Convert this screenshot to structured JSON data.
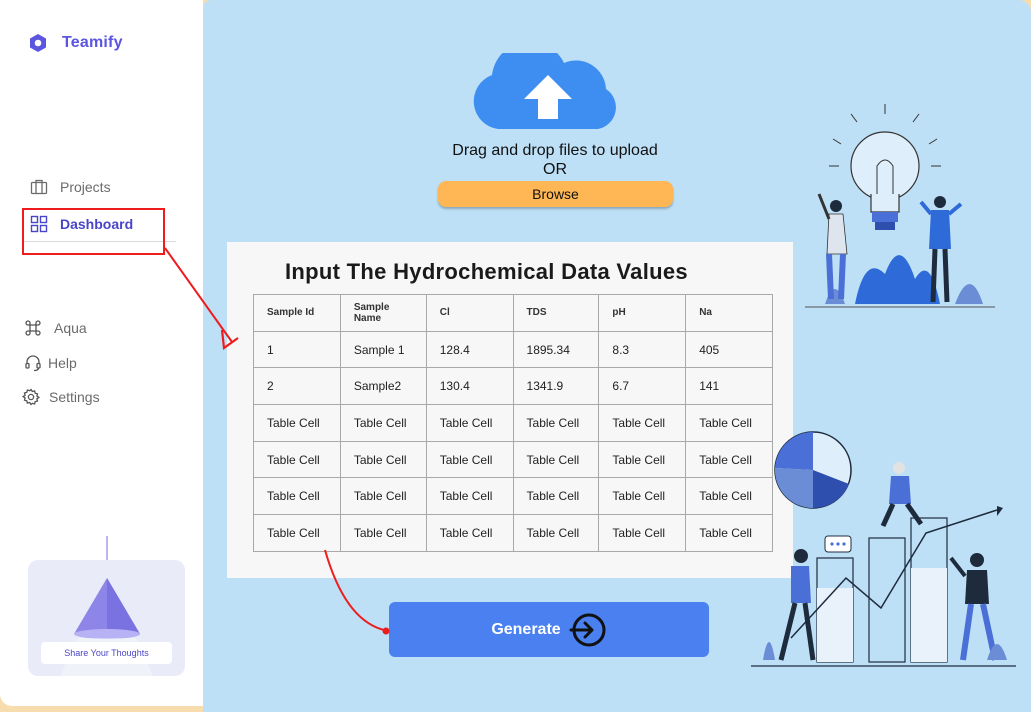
{
  "sidebar": {
    "brand": "Teamify",
    "nav": [
      {
        "label": "Projects",
        "icon": "briefcase-icon"
      },
      {
        "label": "Dashboard",
        "icon": "grid-icon"
      },
      {
        "label": "Aqua",
        "icon": "command-icon"
      },
      {
        "label": "Help",
        "icon": "headset-icon"
      },
      {
        "label": "Settings",
        "icon": "gear-icon"
      }
    ],
    "promo_cta": "Share Your Thoughts"
  },
  "upload": {
    "line1": "Drag and drop files to upload",
    "line2": "OR",
    "browse": "Browse"
  },
  "data_card": {
    "title": "Input The Hydrochemical Data Values",
    "headers": [
      "Sample Id",
      "Sample Name",
      "Cl",
      "TDS",
      "pH",
      "Na"
    ],
    "rows": [
      [
        "1",
        "Sample 1",
        "128.4",
        "1895.34",
        "8.3",
        "405"
      ],
      [
        "2",
        "Sample2",
        "130.4",
        "1341.9",
        "6.7",
        "141"
      ],
      [
        "Table Cell",
        "Table Cell",
        "Table Cell",
        "Table Cell",
        "Table Cell",
        "Table Cell"
      ],
      [
        "Table Cell",
        "Table Cell",
        "Table Cell",
        "Table Cell",
        "Table Cell",
        "Table Cell"
      ],
      [
        "Table Cell",
        "Table Cell",
        "Table Cell",
        "Table Cell",
        "Table Cell",
        "Table Cell"
      ],
      [
        "Table Cell",
        "Table Cell",
        "Table Cell",
        "Table Cell",
        "Table Cell",
        "Table Cell"
      ]
    ]
  },
  "generate": {
    "label": "Generate",
    "icon": "arrow-into-circle-icon"
  },
  "colors": {
    "brand": "#5b55e0",
    "main_bg": "#bde0f6",
    "browse": "#ffb755",
    "generate": "#4a80f0",
    "annotation": "#ee1c1c"
  }
}
